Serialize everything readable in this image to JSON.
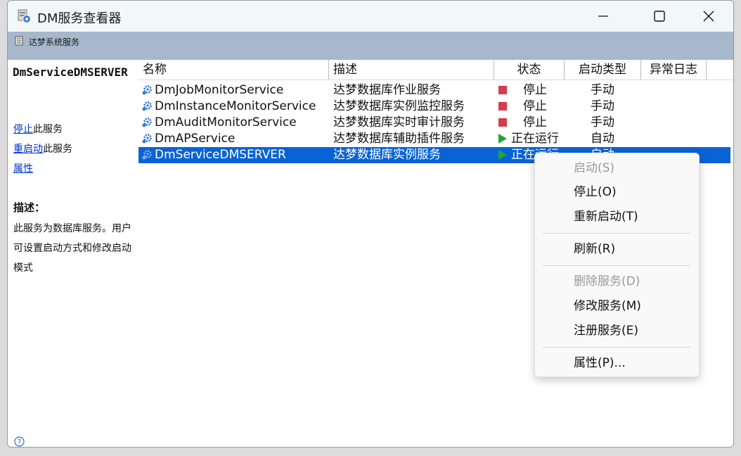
{
  "window": {
    "title": "DM服务查看器"
  },
  "toolbar": {
    "label": "达梦系统服务"
  },
  "left_pane": {
    "service_name": "DmServiceDMSERVER",
    "actions": [
      {
        "link": "停止",
        "suffix": "此服务"
      },
      {
        "link": "重启动",
        "suffix": "此服务"
      },
      {
        "link": "属性",
        "suffix": ""
      }
    ],
    "description_heading": "描述：",
    "description_text": "此服务为数据库服务。用户可设置启动方式和修改启动模式"
  },
  "table": {
    "headers": [
      "名称",
      "描述",
      "状态",
      "启动类型",
      "异常日志"
    ],
    "rows": [
      {
        "name": "DmJobMonitorService",
        "desc": "达梦数据库作业服务",
        "status": "停止",
        "status_kind": "stopped",
        "startup": "手动",
        "log": ""
      },
      {
        "name": "DmInstanceMonitorService",
        "desc": "达梦数据库实例监控服务",
        "status": "停止",
        "status_kind": "stopped",
        "startup": "手动",
        "log": ""
      },
      {
        "name": "DmAuditMonitorService",
        "desc": "达梦数据库实时审计服务",
        "status": "停止",
        "status_kind": "stopped",
        "startup": "手动",
        "log": ""
      },
      {
        "name": "DmAPService",
        "desc": "达梦数据库辅助插件服务",
        "status": "正在运行",
        "status_kind": "running",
        "startup": "自动",
        "log": ""
      },
      {
        "name": "DmServiceDMSERVER",
        "desc": "达梦数据库实例服务",
        "status": "正在运行",
        "status_kind": "running",
        "startup": "自动",
        "log": "",
        "selected": true
      }
    ]
  },
  "context_menu": {
    "items": [
      {
        "label": "启动(S)",
        "disabled": true
      },
      {
        "label": "停止(O)",
        "disabled": false
      },
      {
        "label": "重新启动(T)",
        "disabled": false
      },
      {
        "label": "刷新(R)",
        "disabled": false
      },
      {
        "label": "删除服务(D)",
        "disabled": true
      },
      {
        "label": "修改服务(M)",
        "disabled": false
      },
      {
        "label": "注册服务(E)",
        "disabled": false
      },
      {
        "label": "属性(P)...",
        "disabled": false
      }
    ]
  },
  "colors": {
    "selection": "#0a63d6",
    "toolbar": "#a7b7cc",
    "stopped": "#d63a4f",
    "running": "#22a43c",
    "link": "#0033cc"
  },
  "icons": {
    "app": "services-app-icon",
    "toolbar": "server-icon",
    "service": "gear-service-icon",
    "help": "help-icon"
  }
}
